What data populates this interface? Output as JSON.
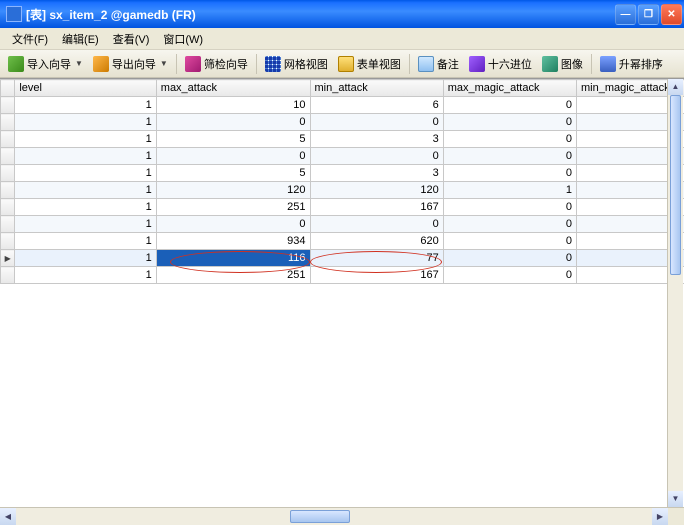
{
  "window": {
    "title": "[表] sx_item_2 @gamedb (FR)"
  },
  "menu": {
    "file": "文件(F)",
    "edit": "编辑(E)",
    "view": "查看(V)",
    "window": "窗口(W)"
  },
  "toolbar": {
    "import": "导入向导",
    "export": "导出向导",
    "filter": "筛检向导",
    "gridview": "网格视图",
    "formview": "表单视图",
    "note": "备注",
    "hex": "十六进位",
    "image": "图像",
    "sort": "升幂排序"
  },
  "columns": {
    "level": "level",
    "max_attack": "max_attack",
    "min_attack": "min_attack",
    "max_magic_attack": "max_magic_attack",
    "min_magic_attack": "min_magic_attack"
  },
  "rows": [
    {
      "level": 1,
      "max_attack": 10,
      "min_attack": 6,
      "max_magic_attack": 0,
      "min_magic_attack": ""
    },
    {
      "level": 1,
      "max_attack": 0,
      "min_attack": 0,
      "max_magic_attack": 0,
      "min_magic_attack": ""
    },
    {
      "level": 1,
      "max_attack": 5,
      "min_attack": 3,
      "max_magic_attack": 0,
      "min_magic_attack": ""
    },
    {
      "level": 1,
      "max_attack": 0,
      "min_attack": 0,
      "max_magic_attack": 0,
      "min_magic_attack": ""
    },
    {
      "level": 1,
      "max_attack": 5,
      "min_attack": 3,
      "max_magic_attack": 0,
      "min_magic_attack": ""
    },
    {
      "level": 1,
      "max_attack": 120,
      "min_attack": 120,
      "max_magic_attack": 1,
      "min_magic_attack": ""
    },
    {
      "level": 1,
      "max_attack": 251,
      "min_attack": 167,
      "max_magic_attack": 0,
      "min_magic_attack": ""
    },
    {
      "level": 1,
      "max_attack": 0,
      "min_attack": 0,
      "max_magic_attack": 0,
      "min_magic_attack": ""
    },
    {
      "level": 1,
      "max_attack": 934,
      "min_attack": 620,
      "max_magic_attack": 0,
      "min_magic_attack": ""
    },
    {
      "level": 1,
      "max_attack": 116,
      "min_attack": 77,
      "max_magic_attack": 0,
      "min_magic_attack": ""
    },
    {
      "level": 1,
      "max_attack": 251,
      "min_attack": 167,
      "max_magic_attack": 0,
      "min_magic_attack": ""
    }
  ],
  "selected_row_index": 9,
  "selected_cell_col": "max_attack"
}
